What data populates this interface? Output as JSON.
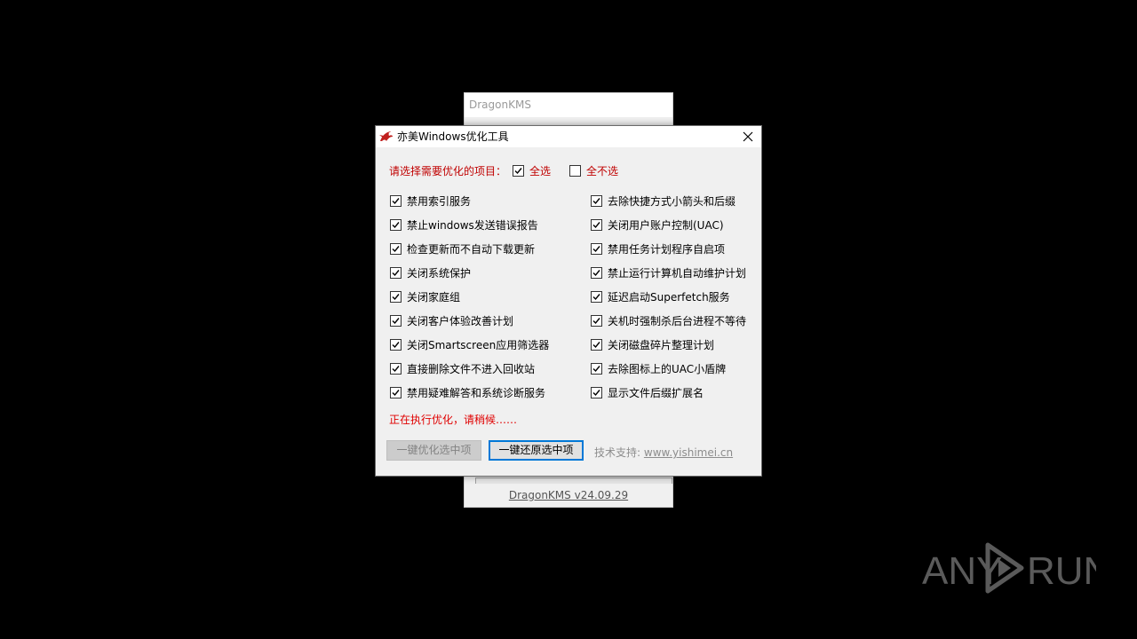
{
  "background_window": {
    "title": "DragonKMS",
    "version_link": "DragonKMS v24.09.29"
  },
  "dialog": {
    "title": "亦美Windows优化工具",
    "prompt": "请选择需要优化的项目：",
    "select_all": "全选",
    "select_none": "全不选",
    "select_all_checked": true,
    "select_none_checked": false,
    "left_items": [
      {
        "label": "禁用索引服务",
        "checked": true
      },
      {
        "label": "禁止windows发送错误报告",
        "checked": true
      },
      {
        "label": "检查更新而不自动下载更新",
        "checked": true
      },
      {
        "label": "关闭系统保护",
        "checked": true
      },
      {
        "label": "关闭家庭组",
        "checked": true
      },
      {
        "label": "关闭客户体验改善计划",
        "checked": true
      },
      {
        "label": "关闭Smartscreen应用筛选器",
        "checked": true
      },
      {
        "label": "直接删除文件不进入回收站",
        "checked": true
      },
      {
        "label": "禁用疑难解答和系统诊断服务",
        "checked": true
      }
    ],
    "right_items": [
      {
        "label": "去除快捷方式小箭头和后缀",
        "checked": true
      },
      {
        "label": "关闭用户账户控制(UAC)",
        "checked": true
      },
      {
        "label": "禁用任务计划程序自启项",
        "checked": true
      },
      {
        "label": "禁止运行计算机自动维护计划",
        "checked": true
      },
      {
        "label": "延迟启动Superfetch服务",
        "checked": true
      },
      {
        "label": "关机时强制杀后台进程不等待",
        "checked": true
      },
      {
        "label": "关闭磁盘碎片整理计划",
        "checked": true
      },
      {
        "label": "去除图标上的UAC小盾牌",
        "checked": true
      },
      {
        "label": "显示文件后缀扩展名",
        "checked": true
      }
    ],
    "status": "正在执行优化，请稍候……",
    "optimize_button": "一键优化选中项",
    "restore_button": "一键还原选中项",
    "support_label": "技术支持:",
    "support_link": "www.yishimei.cn"
  },
  "watermark": {
    "text_left": "ANY",
    "text_right": "RUN"
  },
  "colors": {
    "accent_red": "#c00000",
    "focus_blue": "#0078d7",
    "dialog_bg": "#f0f0f0"
  }
}
